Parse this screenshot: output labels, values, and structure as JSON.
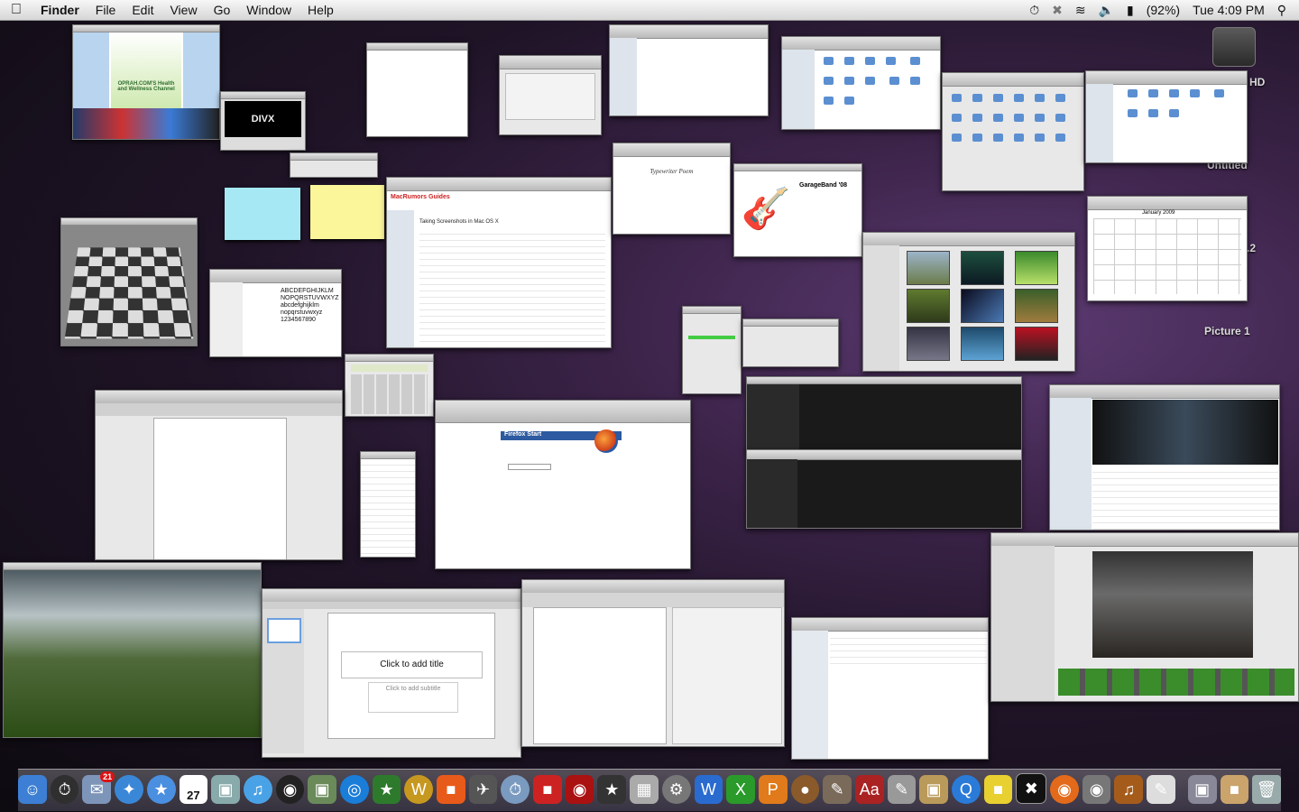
{
  "menubar": {
    "app": "Finder",
    "menus": [
      "File",
      "Edit",
      "View",
      "Go",
      "Window",
      "Help"
    ],
    "battery": "(92%)",
    "clock": "Tue 4:09 PM"
  },
  "desktop_icons": {
    "hd": "HD",
    "untitled": "Untitled",
    "x2": ".2",
    "picture1": "Picture 1"
  },
  "windows": {
    "keynote": {
      "title": "Click to add title",
      "subtitle": "Click to add subtitle"
    },
    "firefox": {
      "heading": "Firefox Start"
    },
    "garageband": {
      "title": "GarageBand '08"
    },
    "article": {
      "heading": "Taking Screenshots in Mac OS X",
      "site": "MacRumors Guides"
    },
    "oprah": {
      "text": "OPRAH.COM'S Health and Wellness Channel"
    },
    "divx": {
      "text": "DIVX"
    },
    "fontbook": {
      "sample": "ABCDEFGHIJKLM NOPQRSTUVWXYZ abcdefghijklm nopqrstuvwxyz 1234567890"
    },
    "textedit_note": {
      "text": "Typewriter Poem"
    },
    "calendar": {
      "title": "January 2009"
    }
  },
  "dock": {
    "calendar_day": "27",
    "mail_badge": "21",
    "items": [
      "finder-icon",
      "dashboard-icon",
      "mail-icon",
      "safari-icon",
      "ichat-icon",
      "ical-icon",
      "preview-icon",
      "itunes-icon",
      "front-row-icon",
      "iphoto-icon",
      "spotlight-icon",
      "game-icon",
      "wow-icon",
      "box-icon",
      "nvidia-icon",
      "time-machine-icon",
      "chair-icon",
      "photobooth-icon",
      "star-icon",
      "calculator-icon",
      "system-preferences-icon",
      "word-icon",
      "excel-icon",
      "powerpoint-icon",
      "coconut-icon",
      "ink-icon",
      "dictionary-icon",
      "script-icon",
      "image-capture-icon",
      "quicktime-icon",
      "stickies-icon",
      "terminal-icon",
      "firefox-icon",
      "camera-icon",
      "garageband-icon",
      "textedit-icon",
      "screen-icon",
      "archive-icon",
      "trash-icon"
    ]
  }
}
